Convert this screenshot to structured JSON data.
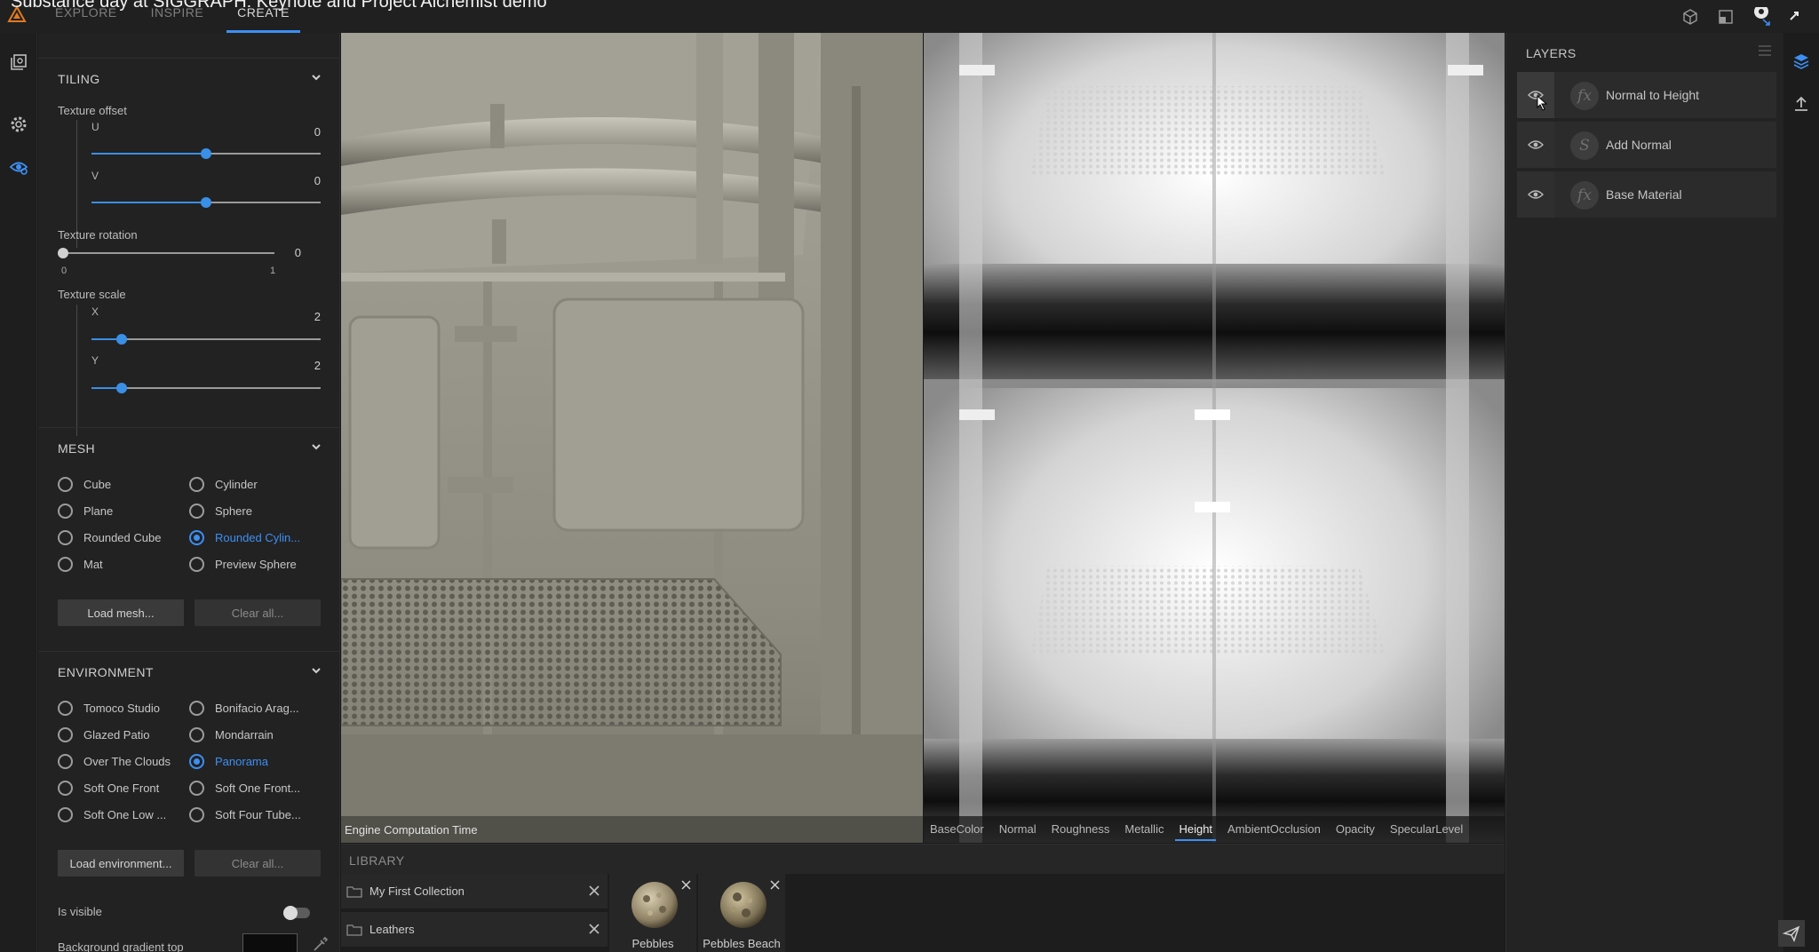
{
  "video_title": "Substance day at SIGGRAPH: Keynote and Project Alchemist demo",
  "nav": {
    "tabs": [
      {
        "label": "EXPLORE",
        "active": false
      },
      {
        "label": "INSPIRE",
        "active": false
      },
      {
        "label": "CREATE",
        "active": true
      }
    ]
  },
  "top_icons": [
    "cube-icon",
    "layout-icon",
    "avatar-icon",
    "share-icon"
  ],
  "left_strip_icons": [
    "library-icon",
    "settings-icon",
    "view-settings-icon"
  ],
  "tiling": {
    "title": "TILING",
    "offset_label": "Texture offset",
    "u_label": "U",
    "u_value": "0",
    "u_level": 0.5,
    "v_label": "V",
    "v_value": "0",
    "v_level": 0.5,
    "rotation_label": "Texture rotation",
    "rotation_value": "0",
    "rotation_level": 0.0,
    "rotation_min": "0",
    "rotation_max": "1",
    "scale_label": "Texture scale",
    "x_label": "X",
    "x_value": "2",
    "x_level": 0.13,
    "y_label": "Y",
    "y_value": "2",
    "y_level": 0.13
  },
  "mesh": {
    "title": "MESH",
    "options": [
      {
        "label": "Cube",
        "selected": false
      },
      {
        "label": "Cylinder",
        "selected": false
      },
      {
        "label": "Plane",
        "selected": false
      },
      {
        "label": "Sphere",
        "selected": false
      },
      {
        "label": "Rounded Cube",
        "selected": false
      },
      {
        "label": "Rounded Cylin...",
        "selected": true
      },
      {
        "label": "Mat",
        "selected": false
      },
      {
        "label": "Preview Sphere",
        "selected": false
      }
    ],
    "load_label": "Load mesh...",
    "clear_label": "Clear all..."
  },
  "environment": {
    "title": "ENVIRONMENT",
    "options": [
      {
        "label": "Tomoco Studio",
        "selected": false
      },
      {
        "label": "Bonifacio Arag...",
        "selected": false
      },
      {
        "label": "Glazed Patio",
        "selected": false
      },
      {
        "label": "Mondarrain",
        "selected": false
      },
      {
        "label": "Over The Clouds",
        "selected": false
      },
      {
        "label": "Panorama",
        "selected": true
      },
      {
        "label": "Soft One Front",
        "selected": false
      },
      {
        "label": "Soft One Front...",
        "selected": false
      },
      {
        "label": "Soft One Low ...",
        "selected": false
      },
      {
        "label": "Soft Four Tube...",
        "selected": false
      }
    ],
    "load_label": "Load environment...",
    "clear_label": "Clear all...",
    "visible_label": "Is visible",
    "visible_on": false,
    "gradient_top_label": "Background gradient top"
  },
  "viewport3d": {
    "caption": "Engine Computation Time"
  },
  "viewport2d": {
    "channels": [
      {
        "label": "BaseColor",
        "active": false
      },
      {
        "label": "Normal",
        "active": false
      },
      {
        "label": "Roughness",
        "active": false
      },
      {
        "label": "Metallic",
        "active": false
      },
      {
        "label": "Height",
        "active": true
      },
      {
        "label": "AmbientOcclusion",
        "active": false
      },
      {
        "label": "Opacity",
        "active": false
      },
      {
        "label": "SpecularLevel",
        "active": false
      }
    ]
  },
  "layers": {
    "title": "LAYERS",
    "items": [
      {
        "name": "Normal to Height",
        "icon": "fx-icon",
        "glyph": "fx"
      },
      {
        "name": "Add Normal",
        "icon": "substance-icon",
        "glyph": "S"
      },
      {
        "name": "Base Material",
        "icon": "fx-icon",
        "glyph": "fx"
      }
    ]
  },
  "library": {
    "title": "LIBRARY",
    "collections": [
      {
        "name": "My First Collection"
      },
      {
        "name": "Leathers"
      }
    ],
    "materials": [
      {
        "name": "Pebbles"
      },
      {
        "name": "Pebbles Beach"
      }
    ]
  },
  "colors": {
    "accent": "#3d8ff3",
    "panel": "#222222",
    "background_swatch": "#0c0c0c"
  }
}
